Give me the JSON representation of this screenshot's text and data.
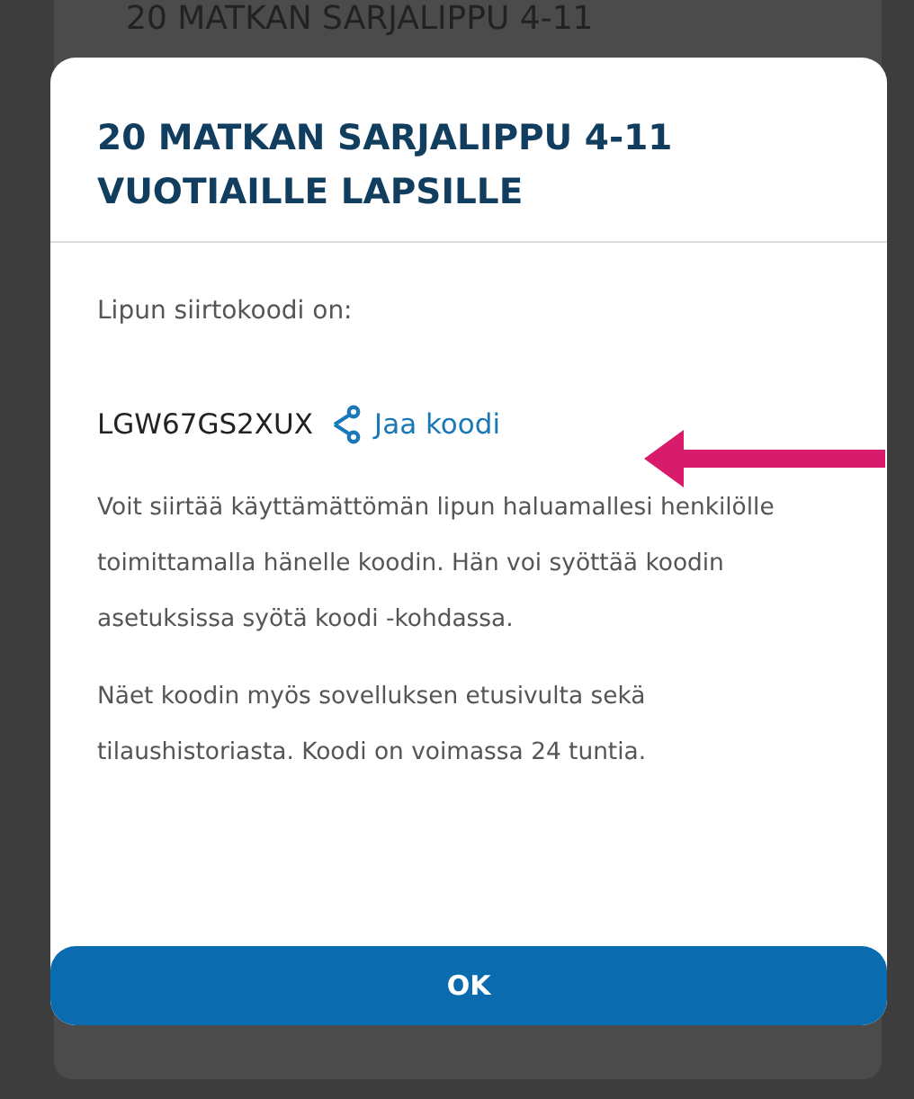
{
  "background_card": {
    "title": "20 MATKAN SARJALIPPU 4-11"
  },
  "dialog": {
    "title": "20 MATKAN SARJALIPPU 4-11 VUOTIAILLE LAPSILLE",
    "code_label": "Lipun siirtokoodi on:",
    "code": "LGW67GS2XUX",
    "share_link": "Jaa koodi",
    "paragraphs": [
      "Voit siirtää käyttämättömän lipun haluamallesi henkilölle toimittamalla hänelle koodin. Hän voi syöttää koodin asetuksissa syötä koodi -kohdassa.",
      "Näet koodin myös sovelluksen etusivulta sekä tilaushistoriasta. Koodi on voimassa 24 tuntia."
    ],
    "ok_button": "OK"
  }
}
